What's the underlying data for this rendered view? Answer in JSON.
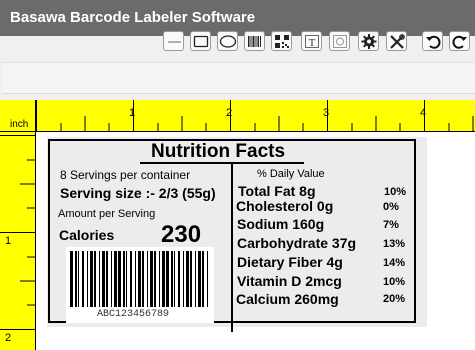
{
  "app": {
    "title": "Basawa Barcode Labeler Software"
  },
  "toolbar": {
    "tools": [
      {
        "name": "line-tool",
        "icon": "line-icon"
      },
      {
        "name": "rectangle-tool",
        "icon": "rectangle-icon"
      },
      {
        "name": "ellipse-tool",
        "icon": "ellipse-icon"
      },
      {
        "name": "barcode-tool",
        "icon": "barcode-icon"
      },
      {
        "name": "qr-code-tool",
        "icon": "qr-code-icon"
      },
      {
        "name": "text-tool",
        "icon": "text-icon"
      },
      {
        "name": "image-tool",
        "icon": "image-icon"
      },
      {
        "name": "settings",
        "icon": "gear-icon"
      },
      {
        "name": "tools",
        "icon": "wrench-screwdriver-icon"
      },
      {
        "name": "undo",
        "icon": "undo-icon"
      },
      {
        "name": "redo",
        "icon": "redo-icon"
      }
    ]
  },
  "ruler": {
    "unit": "inch",
    "top_marks": [
      "1",
      "2",
      "3",
      "4"
    ],
    "left_marks": [
      "1",
      "2"
    ]
  },
  "label": {
    "title": "Nutrition Facts",
    "servings": "8 Servings per container",
    "serving_size": "Serving size :- 2/3 (55g)",
    "amount_per_serving": "Amount per Serving",
    "calories_label": "Calories",
    "calories_value": "230",
    "daily_value_header": "% Daily Value",
    "nutrients": [
      {
        "name": "Total Fat 8g",
        "pct": "10%"
      },
      {
        "name": "Cholesterol 0g",
        "pct": "0%"
      },
      {
        "name": "Sodium  160g",
        "pct": "7%"
      },
      {
        "name": "Carbohydrate 37g",
        "pct": "13%"
      },
      {
        "name": "Dietary Fiber 4g",
        "pct": "14%"
      },
      {
        "name": "Vitamin D 2mcg",
        "pct": "10%"
      },
      {
        "name": "Calcium 260mg",
        "pct": "20%"
      }
    ],
    "barcode_text": "ABC123456789"
  },
  "colors": {
    "titlebar": "#6b6b6b",
    "ruler": "#ffff00",
    "label_background": "#ececec"
  }
}
